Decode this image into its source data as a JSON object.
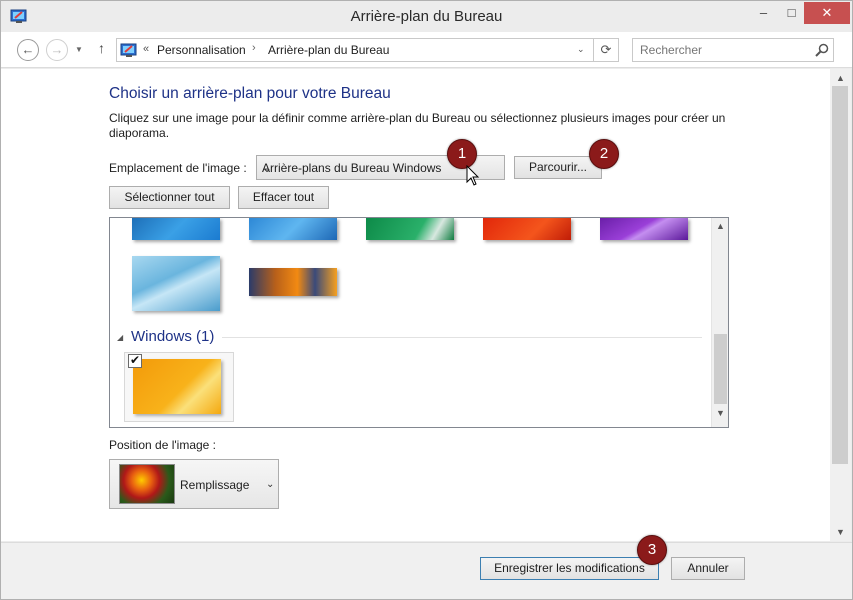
{
  "window": {
    "title": "Arrière-plan du Bureau",
    "minimize": "–",
    "maximize": "□",
    "close": "✕"
  },
  "nav": {
    "back_glyph": "←",
    "forward_glyph": "→",
    "history_glyph": "▼",
    "up_glyph": "↑",
    "address_prefix": "«",
    "breadcrumbs": [
      "Personnalisation",
      "Arrière-plan du Bureau"
    ],
    "crumb_separator": "›",
    "address_dropdown": "⌄",
    "refresh_glyph": "⟳",
    "search_placeholder": "Rechercher"
  },
  "main": {
    "heading": "Choisir un arrière-plan pour votre Bureau",
    "description": "Cliquez sur une image pour la définir comme arrière-plan du Bureau ou sélectionnez plusieurs images pour créer un diaporama.",
    "location_label": "Emplacement de l'image :",
    "location_value": "Arrière-plans du Bureau Windows",
    "browse_label": "Parcourir...",
    "select_all_label": "Sélectionner tout",
    "clear_all_label": "Effacer tout",
    "gallery": {
      "group_title": "Windows (1)",
      "group_toggle": "◢",
      "selected_check": "✔"
    },
    "position_label": "Position de l'image :",
    "position_value": "Remplissage"
  },
  "footer": {
    "save_label": "Enregistrer les modifications",
    "cancel_label": "Annuler"
  },
  "annotations": {
    "badge1": "1",
    "badge2": "2",
    "badge3": "3"
  },
  "colors": {
    "heading": "#1e3287",
    "badge": "#8b1a1a",
    "close_button": "#c75050"
  }
}
